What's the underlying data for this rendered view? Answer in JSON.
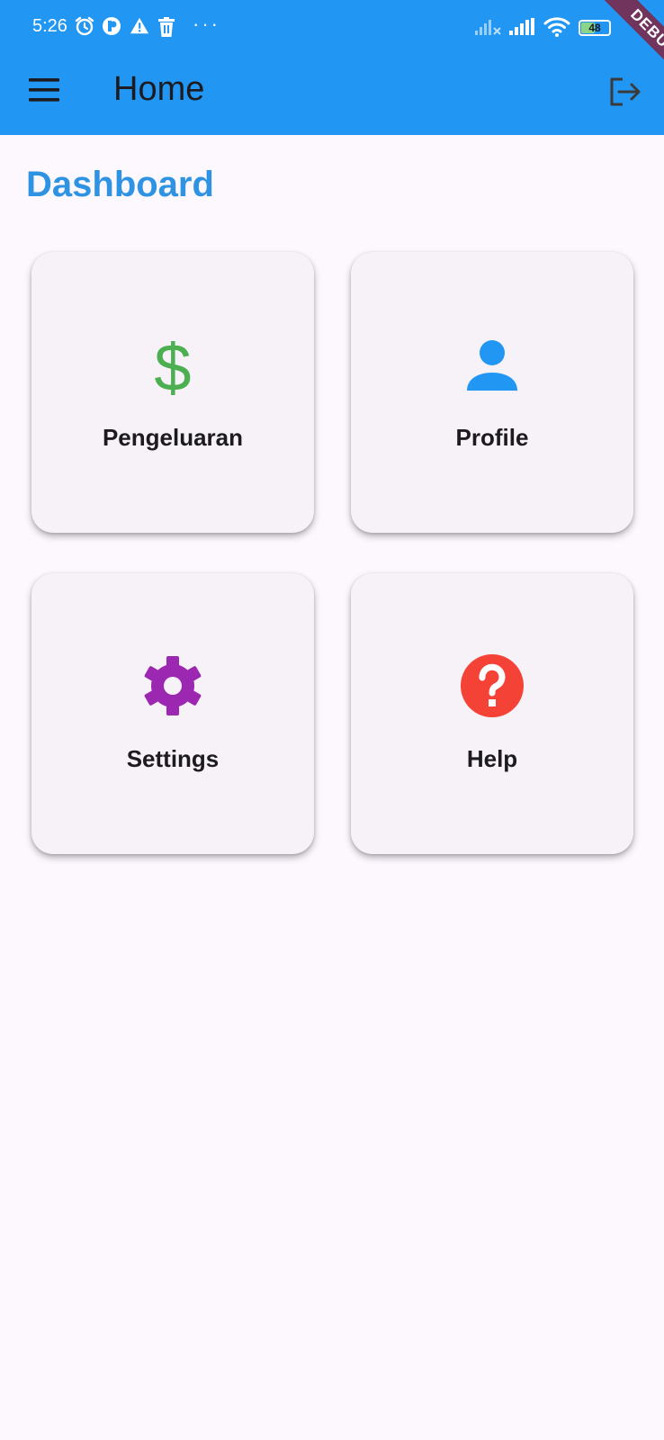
{
  "status_bar": {
    "time": "5:26",
    "more_dots": "···",
    "battery_level": "48",
    "icons": [
      "alarm-icon",
      "app-notification-icon",
      "warning-icon",
      "trash-icon",
      "signal-off-icon",
      "signal-icon",
      "wifi-icon",
      "battery-icon"
    ]
  },
  "app_bar": {
    "title": "Home",
    "menu_icon": "menu-icon",
    "action_icon": "logout-icon",
    "background": "#2196f3"
  },
  "debug_banner": "DEBUG",
  "main": {
    "title": "Dashboard",
    "title_color": "#2f93e3",
    "cards": [
      {
        "label": "Pengeluaran",
        "icon": "dollar-icon",
        "color": "#4caf50"
      },
      {
        "label": "Profile",
        "icon": "person-icon",
        "color": "#2196f3"
      },
      {
        "label": "Settings",
        "icon": "gear-icon",
        "color": "#9c27b0"
      },
      {
        "label": "Help",
        "icon": "help-icon",
        "color": "#f44336"
      }
    ]
  }
}
